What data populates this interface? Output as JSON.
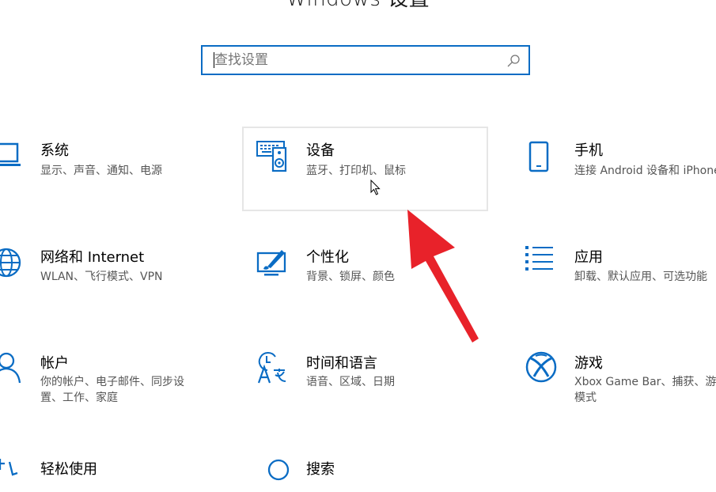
{
  "header": {
    "title": "Windows 设置"
  },
  "search": {
    "placeholder": "查找设置",
    "icon": "search-icon"
  },
  "tiles": [
    {
      "name": "系统",
      "desc": "显示、声音、通知、电源",
      "icon": "laptop-icon"
    },
    {
      "name": "设备",
      "desc": "蓝牙、打印机、鼠标",
      "icon": "keyboard-speaker-icon"
    },
    {
      "name": "手机",
      "desc": "连接 Android 设备和 iPhone",
      "icon": "phone-icon"
    },
    {
      "name": "网络和 Internet",
      "desc": "WLAN、飞行模式、VPN",
      "icon": "globe-icon"
    },
    {
      "name": "个性化",
      "desc": "背景、锁屏、颜色",
      "icon": "paint-monitor-icon"
    },
    {
      "name": "应用",
      "desc": "卸载、默认应用、可选功能",
      "icon": "apps-list-icon"
    },
    {
      "name": "帐户",
      "desc": "你的帐户、电子邮件、同步设",
      "desc2": "置、工作、家庭",
      "icon": "person-icon"
    },
    {
      "name": "时间和语言",
      "desc": "语音、区域、日期",
      "icon": "time-language-icon"
    },
    {
      "name": "游戏",
      "desc": "Xbox Game Bar、捕获、游戏",
      "desc2": "模式",
      "icon": "xbox-icon"
    },
    {
      "name": "轻松使用",
      "icon": "ease-of-access-icon"
    },
    {
      "name": "搜索",
      "icon": "search-icon"
    }
  ],
  "colors": {
    "accent": "#0a6cc4",
    "arrow": "#e8222a",
    "hover_border": "#e6e6e6"
  }
}
